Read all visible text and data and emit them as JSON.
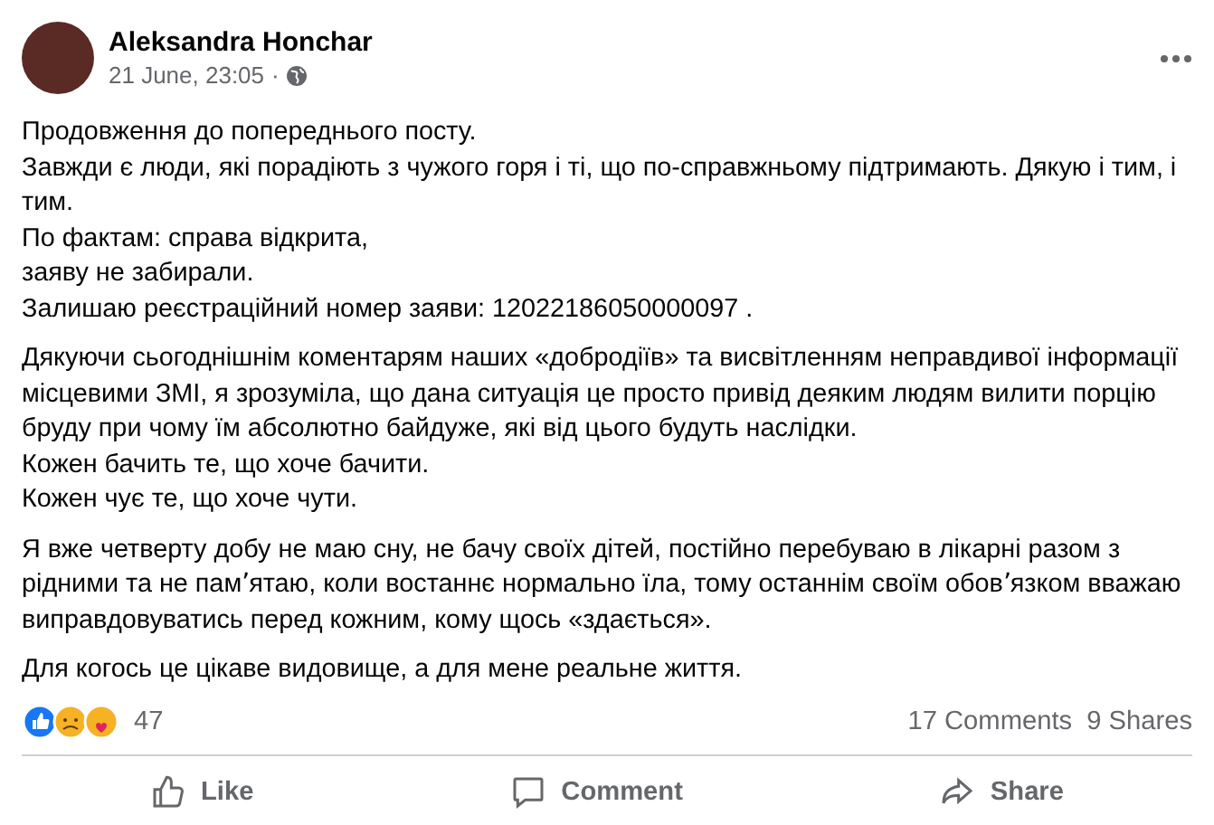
{
  "post": {
    "author": "Aleksandra Honchar",
    "date": "21 June, 23:05",
    "separator": "·",
    "paragraphs": [
      [
        "Продовження до попереднього посту.",
        "Завжди є люди, які порадіють з чужого горя і ті, що по-справжньому підтримають. Дякую і тим, і тим.",
        "По фактам: справа відкрита,",
        "заяву не забирали.",
        "Залишаю реєстраційний номер заяви: 12022186050000097 ."
      ],
      [
        "Дякуючи сьогоднішнім коментарям наших «добродіїв» та висвітленням неправдивої інформації  місцевими ЗМІ, я зрозуміла, що дана ситуація це просто привід деяким людям вилити порцію бруду при чому їм абсолютно байдуже, які від цього будуть наслідки.",
        "Кожен бачить те, що хоче бачити.",
        "Кожен чує те, що хоче чути."
      ],
      [
        "Я вже четверту добу не маю сну, не бачу своїх дітей, постійно перебуваю в лікарні разом з рідними та не пам՚ятаю, коли востаннє нормально їла, тому останнім своїм обов՚язком вважаю виправдовуватись перед кожним, кому щось «здається»."
      ],
      [
        "Для когось це цікаве видовище, а для мене реальне життя."
      ]
    ]
  },
  "stats": {
    "reactions": "47",
    "comments": "17 Comments",
    "shares": "9 Shares"
  },
  "actions": [
    {
      "kind": "like",
      "label": "Like"
    },
    {
      "kind": "comment",
      "label": "Comment"
    },
    {
      "kind": "share",
      "label": "Share"
    }
  ]
}
